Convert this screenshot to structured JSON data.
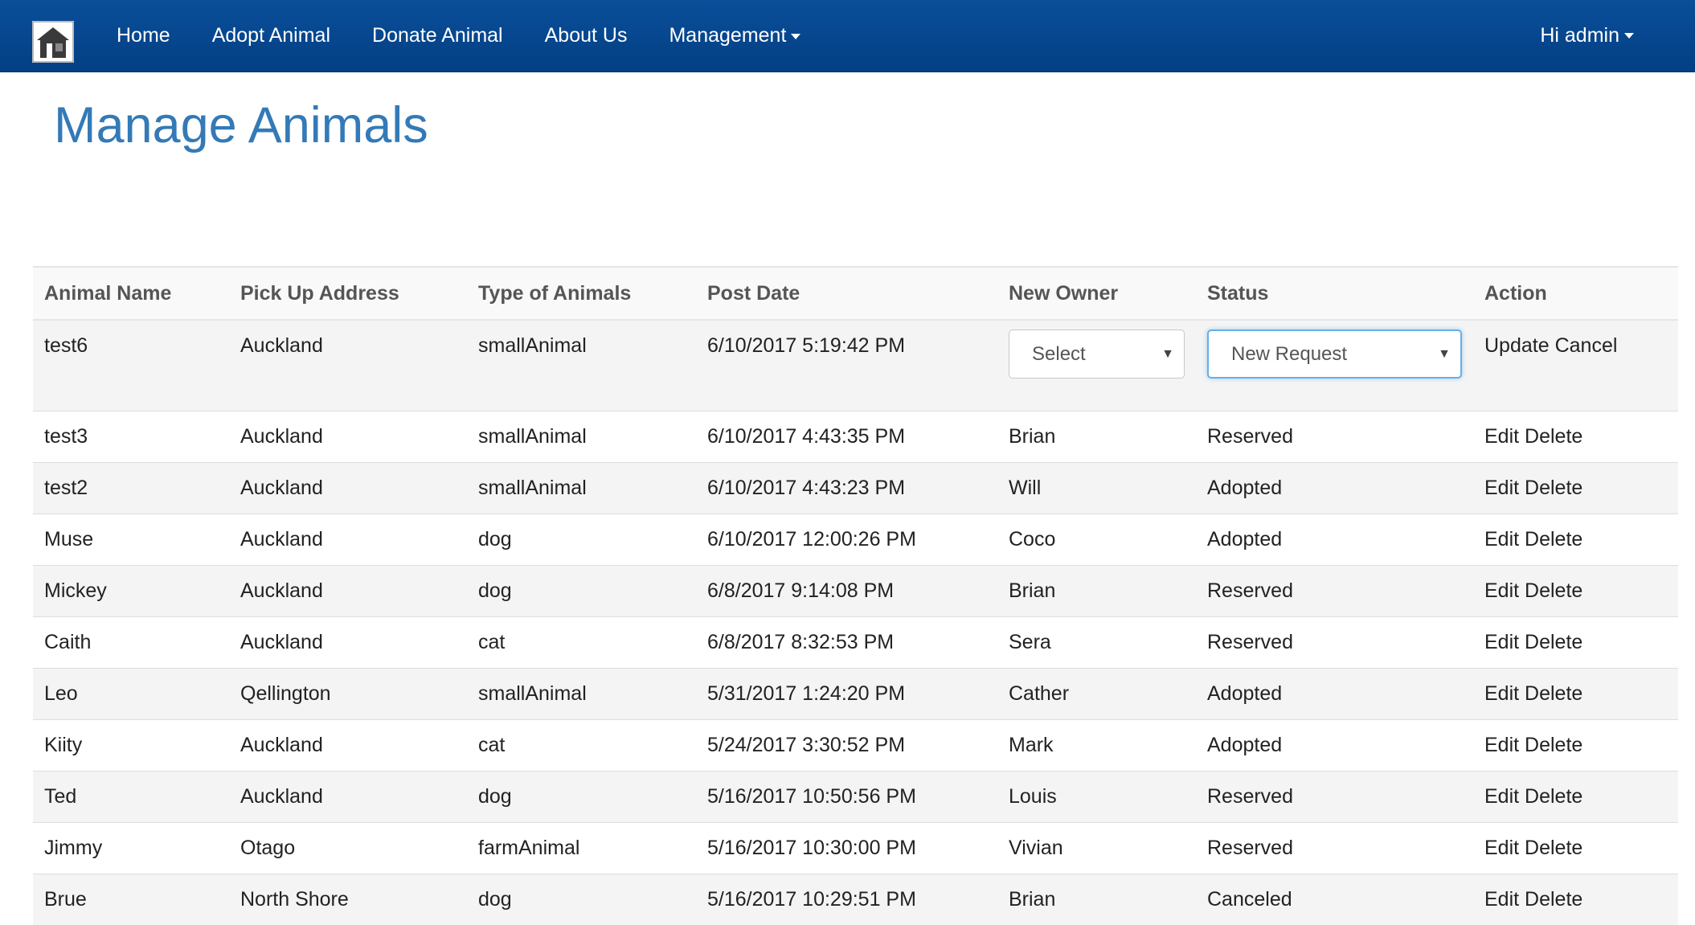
{
  "nav": {
    "logo_icon": "home-animal-logo",
    "links": [
      "Home",
      "Adopt Animal",
      "Donate Animal",
      "About Us"
    ],
    "management_label": "Management",
    "user_label": "Hi admin",
    "background_color": "#0a4f9a"
  },
  "page": {
    "title": "Manage Animals"
  },
  "table": {
    "headers": [
      "Animal Name",
      "Pick Up Address",
      "Type of Animals",
      "Post Date",
      "New Owner",
      "Status",
      "Action"
    ],
    "edit_row": {
      "name": "test6",
      "address": "Auckland",
      "type": "smallAnimal",
      "date": "6/10/2017 5:19:42 PM",
      "owner_select": "Select",
      "status_select": "New Request",
      "update_label": "Update",
      "cancel_label": "Cancel"
    },
    "edit_label": "Edit",
    "delete_label": "Delete",
    "rows": [
      {
        "name": "test3",
        "address": "Auckland",
        "type": "smallAnimal",
        "date": "6/10/2017 4:43:35 PM",
        "owner": "Brian",
        "status": "Reserved"
      },
      {
        "name": "test2",
        "address": "Auckland",
        "type": "smallAnimal",
        "date": "6/10/2017 4:43:23 PM",
        "owner": "Will",
        "status": "Adopted"
      },
      {
        "name": "Muse",
        "address": "Auckland",
        "type": "dog",
        "date": "6/10/2017 12:00:26 PM",
        "owner": "Coco",
        "status": "Adopted"
      },
      {
        "name": "Mickey",
        "address": "Auckland",
        "type": "dog",
        "date": "6/8/2017 9:14:08 PM",
        "owner": "Brian",
        "status": "Reserved"
      },
      {
        "name": "Caith",
        "address": "Auckland",
        "type": "cat",
        "date": "6/8/2017 8:32:53 PM",
        "owner": "Sera",
        "status": "Reserved"
      },
      {
        "name": "Leo",
        "address": "Qellington",
        "type": "smallAnimal",
        "date": "5/31/2017 1:24:20 PM",
        "owner": "Cather",
        "status": "Adopted"
      },
      {
        "name": "Kiity",
        "address": "Auckland",
        "type": "cat",
        "date": "5/24/2017 3:30:52 PM",
        "owner": "Mark",
        "status": "Adopted"
      },
      {
        "name": "Ted",
        "address": "Auckland",
        "type": "dog",
        "date": "5/16/2017 10:50:56 PM",
        "owner": "Louis",
        "status": "Reserved"
      },
      {
        "name": "Jimmy",
        "address": "Otago",
        "type": "farmAnimal",
        "date": "5/16/2017 10:30:00 PM",
        "owner": "Vivian",
        "status": "Reserved"
      },
      {
        "name": "Brue",
        "address": "North Shore",
        "type": "dog",
        "date": "5/16/2017 10:29:51 PM",
        "owner": "Brian",
        "status": "Canceled"
      }
    ]
  }
}
